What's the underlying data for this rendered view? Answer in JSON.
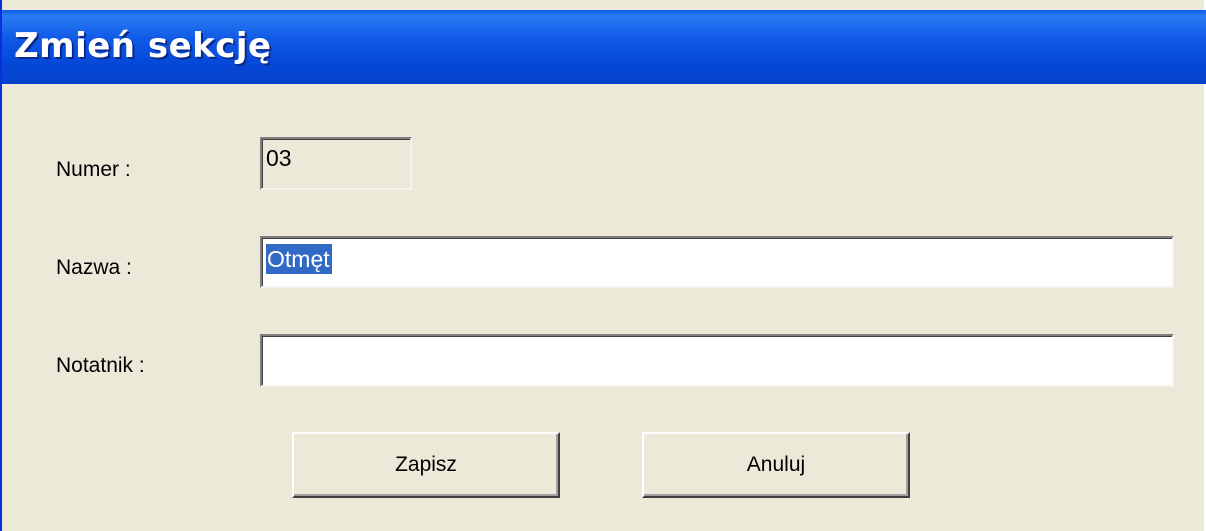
{
  "window": {
    "title": "Zmień sekcję"
  },
  "form": {
    "numer": {
      "label": "Numer :",
      "value": "03"
    },
    "nazwa": {
      "label": "Nazwa :",
      "value": "Otmęt",
      "selected": true
    },
    "notatnik": {
      "label": "Notatnik :",
      "value": ""
    }
  },
  "buttons": {
    "save_label": "Zapisz",
    "cancel_label": "Anuluj"
  },
  "colors": {
    "titlebar": "#0a5be8",
    "dialog_background": "#ece9d8",
    "selection": "#316ac5"
  }
}
